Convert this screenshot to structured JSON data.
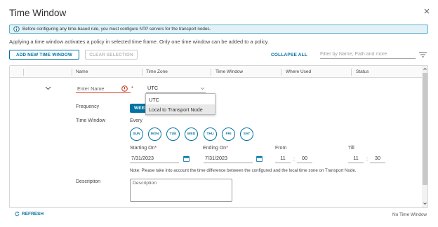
{
  "dialog": {
    "title": "Time Window",
    "close_icon": "close-icon"
  },
  "banner": {
    "icon": "info-icon",
    "text": "Before configuring any time-based rule, you must configure NTP servers for the transport nodes."
  },
  "description": "Applying a time window activates a policy in selected time frame. Only one time window can be added to a policy.",
  "toolbar": {
    "add_label": "ADD NEW TIME WINDOW",
    "clear_label": "CLEAR SELECTION",
    "collapse_label": "COLLAPSE ALL",
    "filter_placeholder": "Filter by Name, Path and more",
    "filter_icon": "filter-icon"
  },
  "grid": {
    "columns": [
      "Name",
      "Time Zone",
      "Time Window",
      "Where Used",
      "Status"
    ],
    "row": {
      "name_placeholder": "Enter Name",
      "name_required": "*",
      "timezone_value": "UTC",
      "timezone_options": [
        "UTC",
        "Local to Transport Node"
      ],
      "frequency_label": "Frequency",
      "frequency_button": "WEEKLY",
      "timewindow_label": "Time Window",
      "every_label": "Every",
      "days": [
        "SUN",
        "MON",
        "TUE",
        "WED",
        "THU",
        "FRI",
        "SAT"
      ],
      "starting_label": "Starting On",
      "ending_label": "Ending On",
      "from_label": "From",
      "till_label": "Till",
      "required_star": "*",
      "start_date": "7/31/2023",
      "end_date": "7/31/2023",
      "from_hour": "11",
      "from_min": "00",
      "till_hour": "11",
      "till_min": "30",
      "time_sep": ":",
      "note": "Note: Please take into account the time difference between the configured and the local time zone on Transport Node.",
      "description_label": "Description",
      "description_placeholder": "Description"
    }
  },
  "footer": {
    "refresh_label": "REFRESH",
    "count_text": "No Time Window"
  },
  "colors": {
    "accent": "#0072a3",
    "error": "#c21d00",
    "banner_bg": "#e1f1f6",
    "banner_border": "#5aaed1"
  }
}
